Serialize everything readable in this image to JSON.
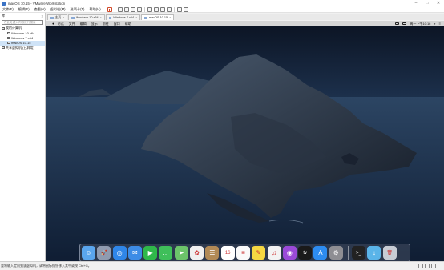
{
  "window": {
    "title": "macOS 10.15 - VMware Workstation"
  },
  "menu": [
    "文件(F)",
    "编辑(E)",
    "查看(V)",
    "虚拟机(M)",
    "选项卡(T)",
    "帮助(H)"
  ],
  "sidebar": {
    "header": "库",
    "search_placeholder": "在此处键入内容进行搜索",
    "items": [
      {
        "label": "我的计算机",
        "level": 0
      },
      {
        "label": "Windows 10 x64",
        "level": 1
      },
      {
        "label": "Windows 7 x64",
        "level": 1
      },
      {
        "label": "macOS 10.15",
        "level": 1
      },
      {
        "label": "共享虚拟机 (已弃用)",
        "level": 0
      }
    ]
  },
  "tabs": [
    {
      "label": "主页",
      "active": false
    },
    {
      "label": "Windows 10 x64",
      "active": false
    },
    {
      "label": "Windows 7 x64",
      "active": false
    },
    {
      "label": "macOS 10.15",
      "active": true
    }
  ],
  "mac_menubar": {
    "items": [
      "访达",
      "文件",
      "编辑",
      "显示",
      "前往",
      "窗口",
      "帮助"
    ],
    "clock": "周一下午10:16"
  },
  "dock": [
    {
      "name": "finder-icon",
      "bg": "#5aa6ee",
      "glyph": "☺"
    },
    {
      "name": "launchpad-icon",
      "bg": "#8f9bb0",
      "glyph": "🚀"
    },
    {
      "name": "safari-icon",
      "bg": "#2f86e8",
      "glyph": "◎"
    },
    {
      "name": "mail-icon",
      "bg": "#3d8ce6",
      "glyph": "✉"
    },
    {
      "name": "facetime-icon",
      "bg": "#2fb84a",
      "glyph": "▶"
    },
    {
      "name": "messages-icon",
      "bg": "#3fbf5a",
      "glyph": "…"
    },
    {
      "name": "maps-icon",
      "bg": "#6cc46a",
      "glyph": "➤"
    },
    {
      "name": "photos-icon",
      "bg": "#f0f0f0",
      "glyph": "✿"
    },
    {
      "name": "contacts-icon",
      "bg": "#b28a56",
      "glyph": "☰"
    },
    {
      "name": "calendar-icon",
      "bg": "#ffffff",
      "glyph": "16"
    },
    {
      "name": "reminders-icon",
      "bg": "#fafafa",
      "glyph": "≡"
    },
    {
      "name": "notes-icon",
      "bg": "#f5d742",
      "glyph": "✎"
    },
    {
      "name": "music-icon",
      "bg": "#f3f3f3",
      "glyph": "♫"
    },
    {
      "name": "podcasts-icon",
      "bg": "#9a4ad8",
      "glyph": "◉"
    },
    {
      "name": "tv-icon",
      "bg": "#1a1a1a",
      "glyph": "tv"
    },
    {
      "name": "app-store-icon",
      "bg": "#2d8cf0",
      "glyph": "A"
    },
    {
      "name": "system-preferences-icon",
      "bg": "#8e8e93",
      "glyph": "⚙"
    },
    {
      "name": "terminal-icon",
      "bg": "#222222",
      "glyph": ">_"
    },
    {
      "name": "downloads-folder-icon",
      "bg": "#5ab4e8",
      "glyph": "↓"
    },
    {
      "name": "trash-icon",
      "bg": "#c7ccd4",
      "glyph": "🗑"
    }
  ],
  "statusbar": {
    "text": "要将输入定向到该虚拟机，请将鼠标指针移入其中或按 Ctrl+G。"
  }
}
